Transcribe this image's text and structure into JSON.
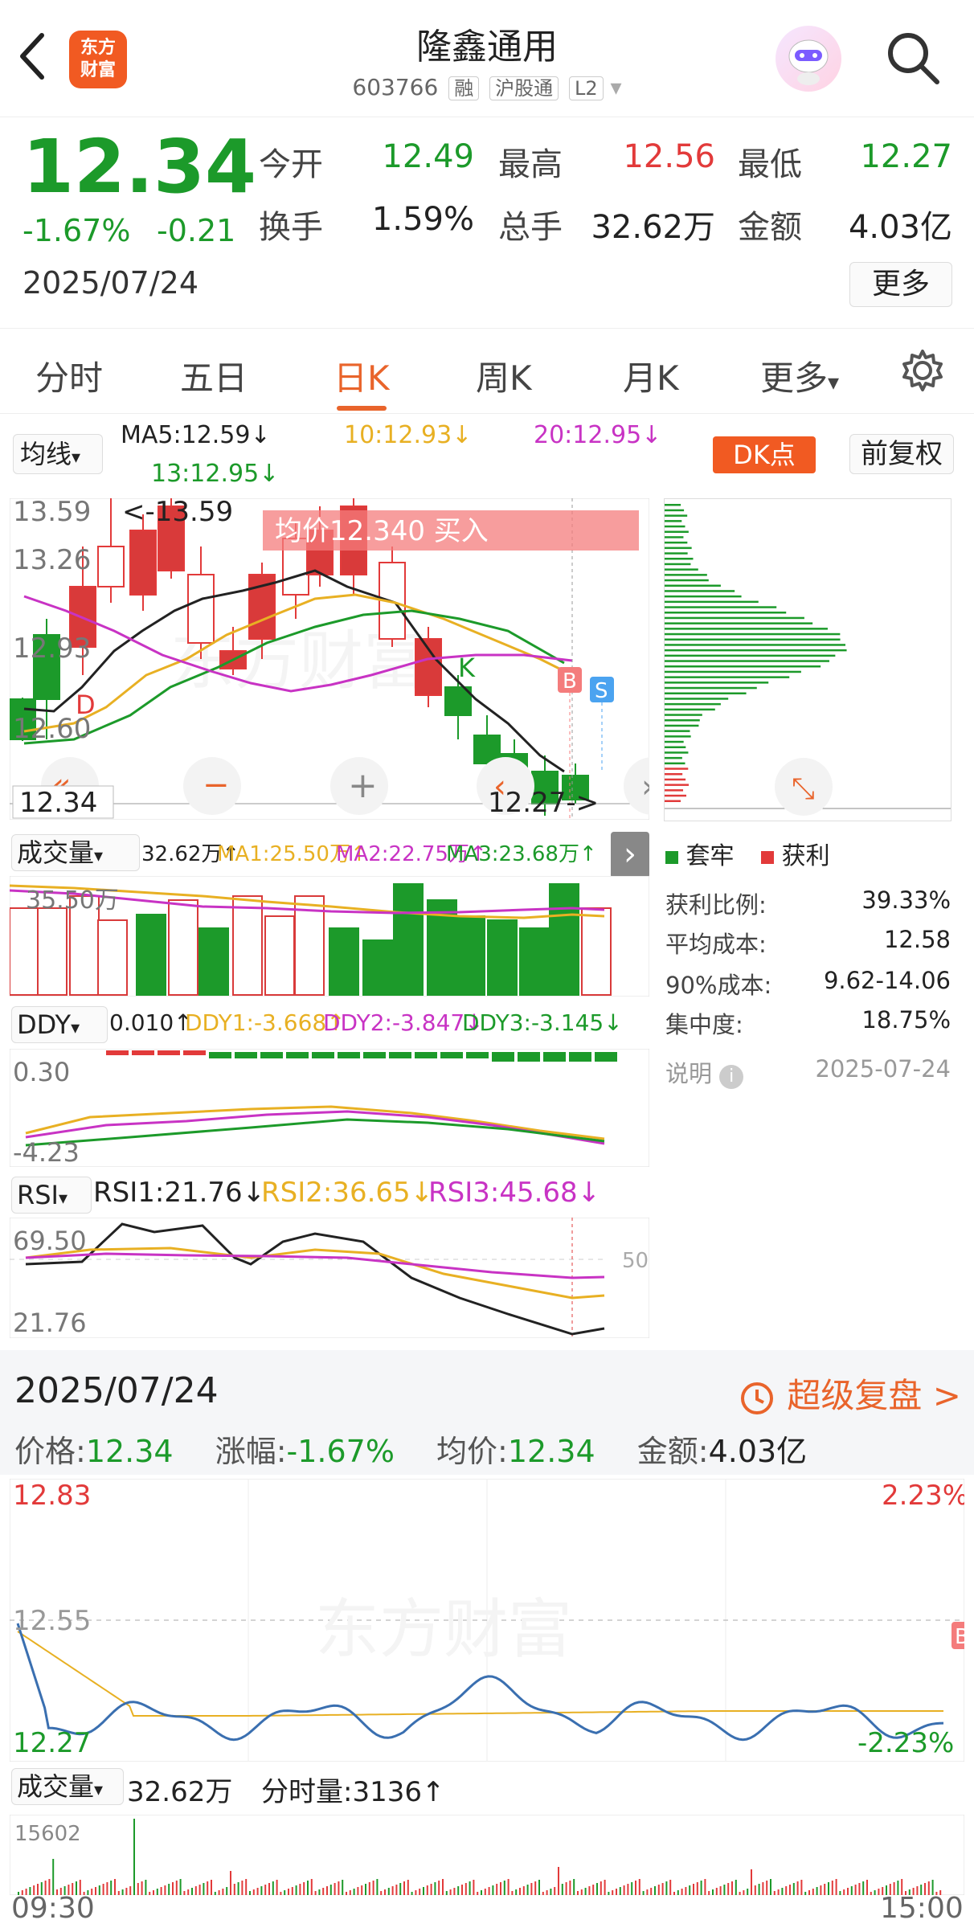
{
  "header": {
    "back_icon": "chevron-left-icon",
    "logo_text": "东方\n财富",
    "title": "隆鑫通用",
    "code": "603766",
    "tags": [
      "融",
      "沪股通",
      "L2"
    ]
  },
  "quote": {
    "price": "12.34",
    "pct": "-1.67%",
    "chg": "-0.21",
    "date": "2025/07/24",
    "open_label": "今开",
    "open": "12.49",
    "high_label": "最高",
    "high": "12.56",
    "low_label": "最低",
    "low": "12.27",
    "turnover_label": "换手",
    "turnover": "1.59%",
    "volume_label": "总手",
    "volume": "32.62万",
    "amount_label": "金额",
    "amount": "4.03亿",
    "more": "更多"
  },
  "tabs": {
    "items": [
      "分时",
      "五日",
      "日K",
      "周K",
      "月K",
      "更多"
    ],
    "active": "日K"
  },
  "kline_legend": {
    "selector": "均线",
    "ma5": "MA5:12.59↓",
    "ma10": "10:12.93↓",
    "ma20": "20:12.95↓",
    "ma13": "13:12.95↓",
    "dk": "DK点",
    "fuquan": "前复权"
  },
  "kline": {
    "axis": [
      "13.59",
      "13.26",
      "12.93",
      "12.60"
    ],
    "max_marker": "<-13.59",
    "cur_price": "12.34",
    "min_marker": "12.27->",
    "banner": "均价12.340  买入",
    "label_d": "D",
    "label_k": "K",
    "label_b": "B",
    "label_s": "S"
  },
  "volume_legend": {
    "selector": "成交量",
    "vol": "32.62万↑",
    "ma1": "MA1:25.50万↑",
    "ma2": "MA2:22.75万↑",
    "ma3": "MA3:23.68万↑",
    "axis_top": "35.50万"
  },
  "ddy_legend": {
    "selector": "DDY",
    "val": "0.010↑",
    "ddy1": "DDY1:-3.668↑",
    "ddy2": "DDY2:-3.847↓",
    "ddy3": "DDY3:-3.145↓",
    "axis_top": "0.30",
    "axis_bottom": "-4.23"
  },
  "rsi_legend": {
    "selector": "RSI",
    "rsi1": "RSI1:21.76↓",
    "rsi2": "RSI2:36.65↓",
    "rsi3": "RSI3:45.68↓",
    "axis_top": "69.50",
    "axis_bottom": "21.76",
    "mid": "50"
  },
  "chip": {
    "legend_trapped": "套牢",
    "legend_profit": "获利",
    "rows": [
      {
        "label": "获利比例:",
        "value": "39.33%"
      },
      {
        "label": "平均成本:",
        "value": "12.58"
      },
      {
        "label": "90%成本:",
        "value": "9.62-14.06"
      },
      {
        "label": "集中度:",
        "value": "18.75%"
      }
    ],
    "note": "说明",
    "note_date": "2025-07-24"
  },
  "detail": {
    "date": "2025/07/24",
    "super": "超级复盘 >",
    "price_label": "价格:",
    "price": "12.34",
    "pct_label": "涨幅:",
    "pct": "-1.67%",
    "avg_label": "均价:",
    "avg": "12.34",
    "amt_label": "金额:",
    "amt": "4.03亿"
  },
  "intraday": {
    "y_top": "12.83",
    "y_mid": "12.55",
    "y_bottom": "12.27",
    "pct_top": "2.23%",
    "pct_bottom": "-2.23%",
    "b_marker": "B",
    "vol_selector": "成交量",
    "vol_total": "32.62万",
    "vol_minute": "分时量:3136↑",
    "vol_axis": "15602",
    "t_start": "09:30",
    "t_end": "15:00"
  },
  "watermark": "东方财富",
  "colors": {
    "up": "#e23a3a",
    "down": "#1c9a2a",
    "accent": "#e9642b"
  }
}
